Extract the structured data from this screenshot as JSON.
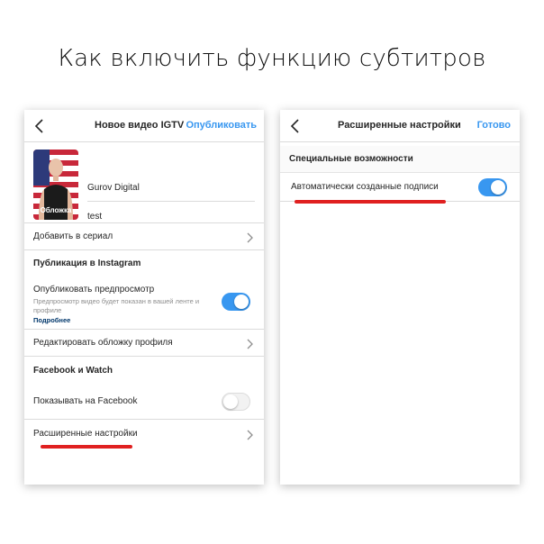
{
  "headline": "Как включить функцию субтитров",
  "accent_color": "#3897f0",
  "underline_color": "#e02020",
  "left_screen": {
    "nav": {
      "back_icon": "chevron-left-icon",
      "title": "Новое видео IGTV",
      "action": "Опубликовать"
    },
    "cover": {
      "label": "Обложка",
      "author": "Gurov Digital",
      "title": "test"
    },
    "add_to_series": "Добавить в сериал",
    "instagram_section": "Публикация в Instagram",
    "preview": {
      "label": "Опубликовать предпросмотр",
      "description": "Предпросмотр видео будет показан в вашей ленте и профиле",
      "more_link": "Подробнее",
      "enabled": true
    },
    "edit_cover": "Редактировать обложку профиля",
    "facebook_section": "Facebook и Watch",
    "show_on_facebook": {
      "label": "Показывать на Facebook",
      "enabled": false
    },
    "advanced": "Расширенные настройки"
  },
  "right_screen": {
    "nav": {
      "back_icon": "chevron-left-icon",
      "title": "Расширенные настройки",
      "action": "Готово"
    },
    "accessibility_section": "Специальные возможности",
    "auto_captions": {
      "label": "Автоматически созданные подписи",
      "enabled": true
    }
  }
}
